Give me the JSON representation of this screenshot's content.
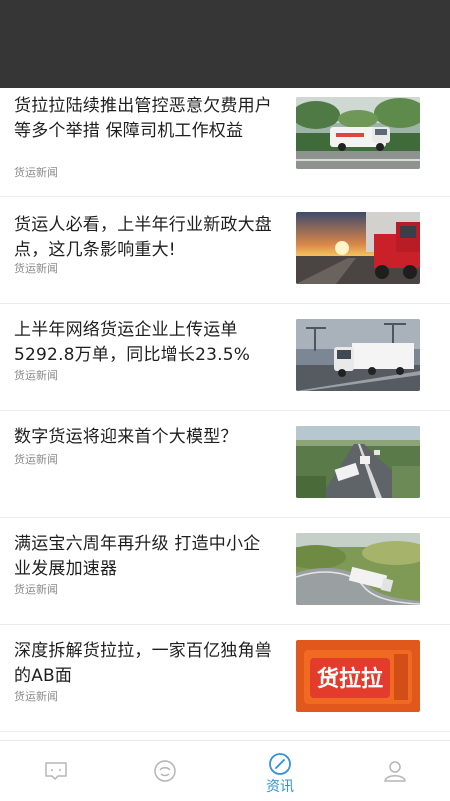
{
  "feed": {
    "items": [
      {
        "title": "货拉拉陆续推出管控恶意欠费用户等多个举措 保障司机工作权益",
        "source": "货运新闻",
        "image": "white-van-roadside-photo"
      },
      {
        "title": "货运人必看，上半年行业新政大盘点，这几条影响重大!",
        "source": "货运新闻",
        "image": "red-truck-sunset-photo"
      },
      {
        "title": "上半年网络货运企业上传运单5292.8万单，同比增长23.5%",
        "source": "货运新闻",
        "image": "white-truck-highway-cranes-photo"
      },
      {
        "title": "数字货运将迎来首个大模型？",
        "source": "货运新闻",
        "image": "trucks-on-highway-aerial-photo"
      },
      {
        "title": "满运宝六周年再升级 打造中小企业发展加速器",
        "source": "货运新闻",
        "image": "truck-on-curved-road-photo"
      },
      {
        "title": "深度拆解货拉拉，一家百亿独角兽的AB面",
        "source": "货运新闻",
        "image": "huolala-logo-photo",
        "logo_text": "货拉拉"
      }
    ]
  },
  "tabbar": {
    "tabs": [
      {
        "icon": "message-icon",
        "label": "",
        "active": false
      },
      {
        "icon": "face-icon",
        "label": "",
        "active": false
      },
      {
        "icon": "compass-icon",
        "label": "资讯",
        "active": true
      },
      {
        "icon": "person-icon",
        "label": "",
        "active": false
      }
    ],
    "active_color": "#2f93d6",
    "inactive_color": "#b5b5b5"
  }
}
